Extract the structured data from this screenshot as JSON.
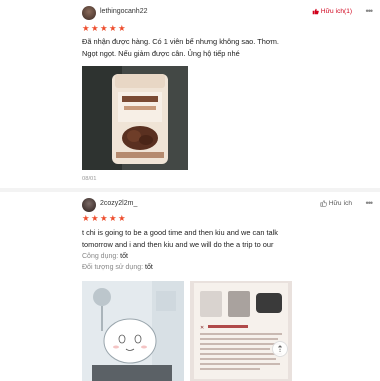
{
  "reviews": [
    {
      "username": "lethingocanh22",
      "helpful_label": "Hữu ích(1)",
      "rating": 5,
      "text_lines": [
        "Đã nhận được hàng. Có 1 viên bể nhưng không sao. Thơm.",
        "Ngọt ngọt. Nếu giảm được cân. Ủng hộ tiếp nhé"
      ],
      "date": "08/01",
      "image_icon": "chocolate-jar-photo"
    },
    {
      "username": "2cozy2l2m_",
      "helpful_label": "Hữu ích",
      "rating": 5,
      "text_lines": [
        "t chi is going to be a good time and then kiu and we can talk",
        "tomorrow and i and then kiu and we will do the a trip to our"
      ],
      "attributes": [
        {
          "label": "Công dụng:",
          "value": "tốt"
        },
        {
          "label": "Đối tượng sử dụng:",
          "value": "tốt"
        }
      ],
      "image_icons": [
        "shower-cartoon-photo",
        "product-instructions-photo"
      ]
    }
  ],
  "icons": {
    "thumb": "thumbs-up-icon",
    "more": "more-dots-icon",
    "scroll_top": "scroll-top-icon"
  },
  "colors": {
    "accent": "#ee4d2d",
    "helpful_active": "#d0011b"
  }
}
